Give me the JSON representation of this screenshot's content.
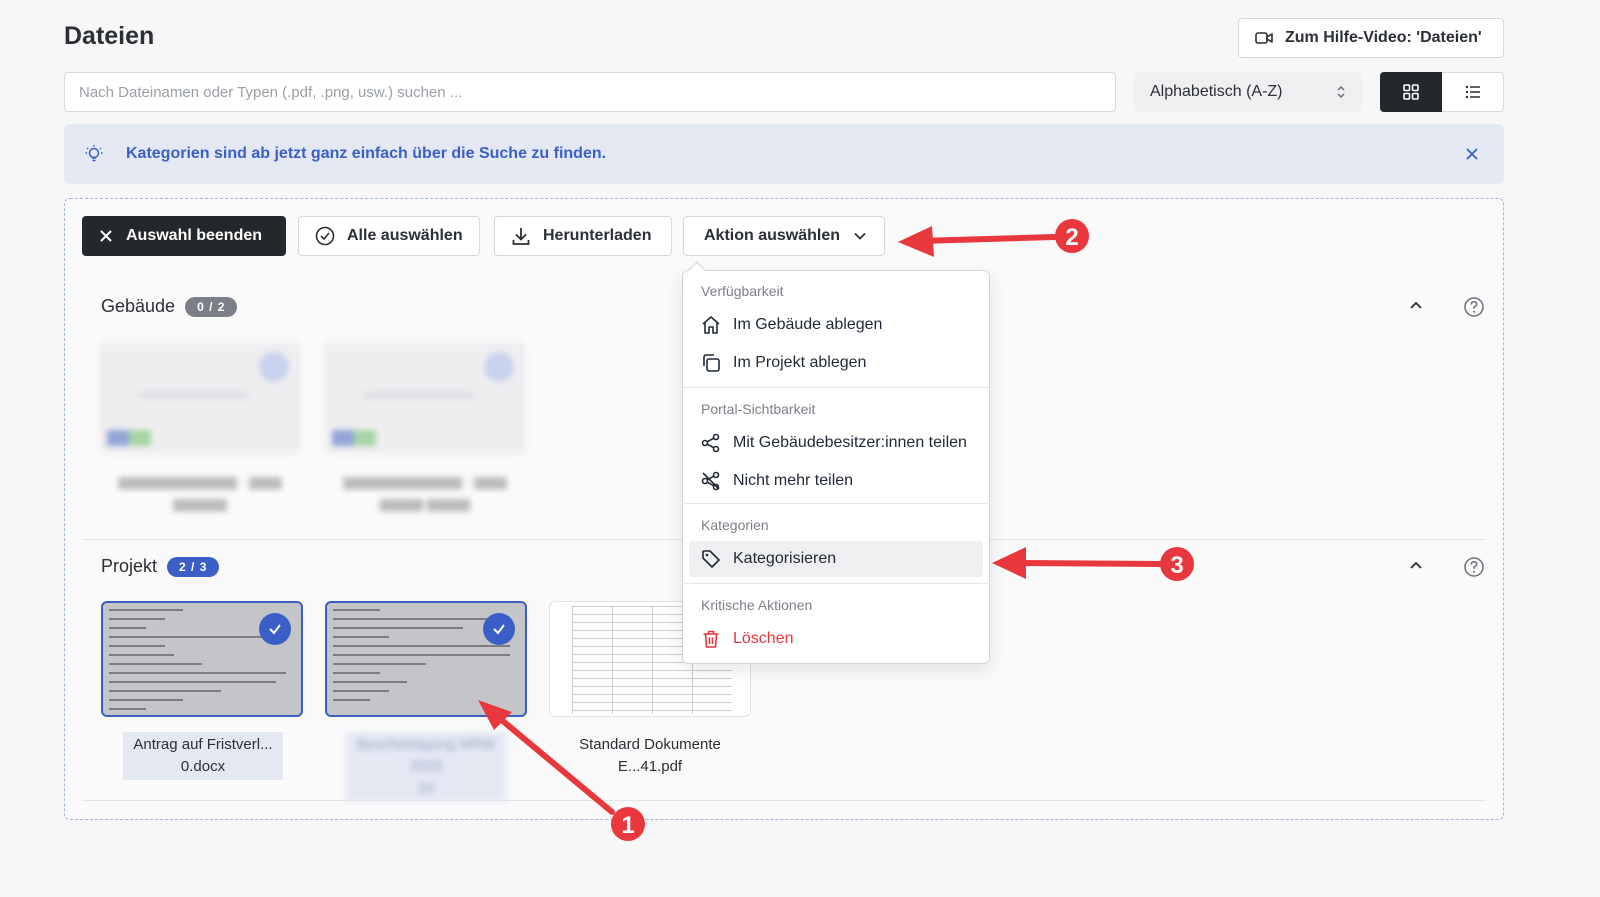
{
  "page": {
    "title": "Dateien"
  },
  "help_video": {
    "label": "Zum Hilfe-Video: 'Dateien'",
    "icon": "video-camera-icon"
  },
  "search": {
    "placeholder": "Nach Dateinamen oder Typen (.pdf, .png, usw.) suchen ..."
  },
  "sort": {
    "selected": "Alphabetisch (A-Z)"
  },
  "view": {
    "active": "grid"
  },
  "info_banner": {
    "text": "Kategorien sind ab jetzt ganz einfach über die Suche zu finden."
  },
  "toolbar": {
    "end_selection": "Auswahl beenden",
    "select_all": "Alle auswählen",
    "download": "Herunterladen",
    "action": "Aktion auswählen"
  },
  "sections": {
    "building": {
      "title": "Gebäude",
      "count": "0 / 2"
    },
    "project": {
      "title": "Projekt",
      "count": "2 / 3"
    }
  },
  "files": [
    {
      "name_line1": "Antrag auf Fristverl...",
      "name_line2": "0.docx",
      "selected": true
    },
    {
      "name_line1": "Bescheinigung NRW 2025",
      "name_line2": "20",
      "selected": true,
      "blurred": true
    },
    {
      "name_line1": "Standard Dokumente",
      "name_line2": "E...41.pdf",
      "selected": false
    }
  ],
  "menu": {
    "group1": "Verfügbarkeit",
    "item_building": "Im Gebäude ablegen",
    "item_project": "Im Projekt ablegen",
    "group2": "Portal-Sichtbarkeit",
    "item_share": "Mit Gebäudebesitzer:innen teilen",
    "item_unshare": "Nicht mehr teilen",
    "group3": "Kategorien",
    "item_categorize": "Kategorisieren",
    "group4": "Kritische Aktionen",
    "item_delete": "Löschen"
  },
  "annotations": {
    "n1": "1",
    "n2": "2",
    "n3": "3",
    "color": "#e8383d"
  }
}
